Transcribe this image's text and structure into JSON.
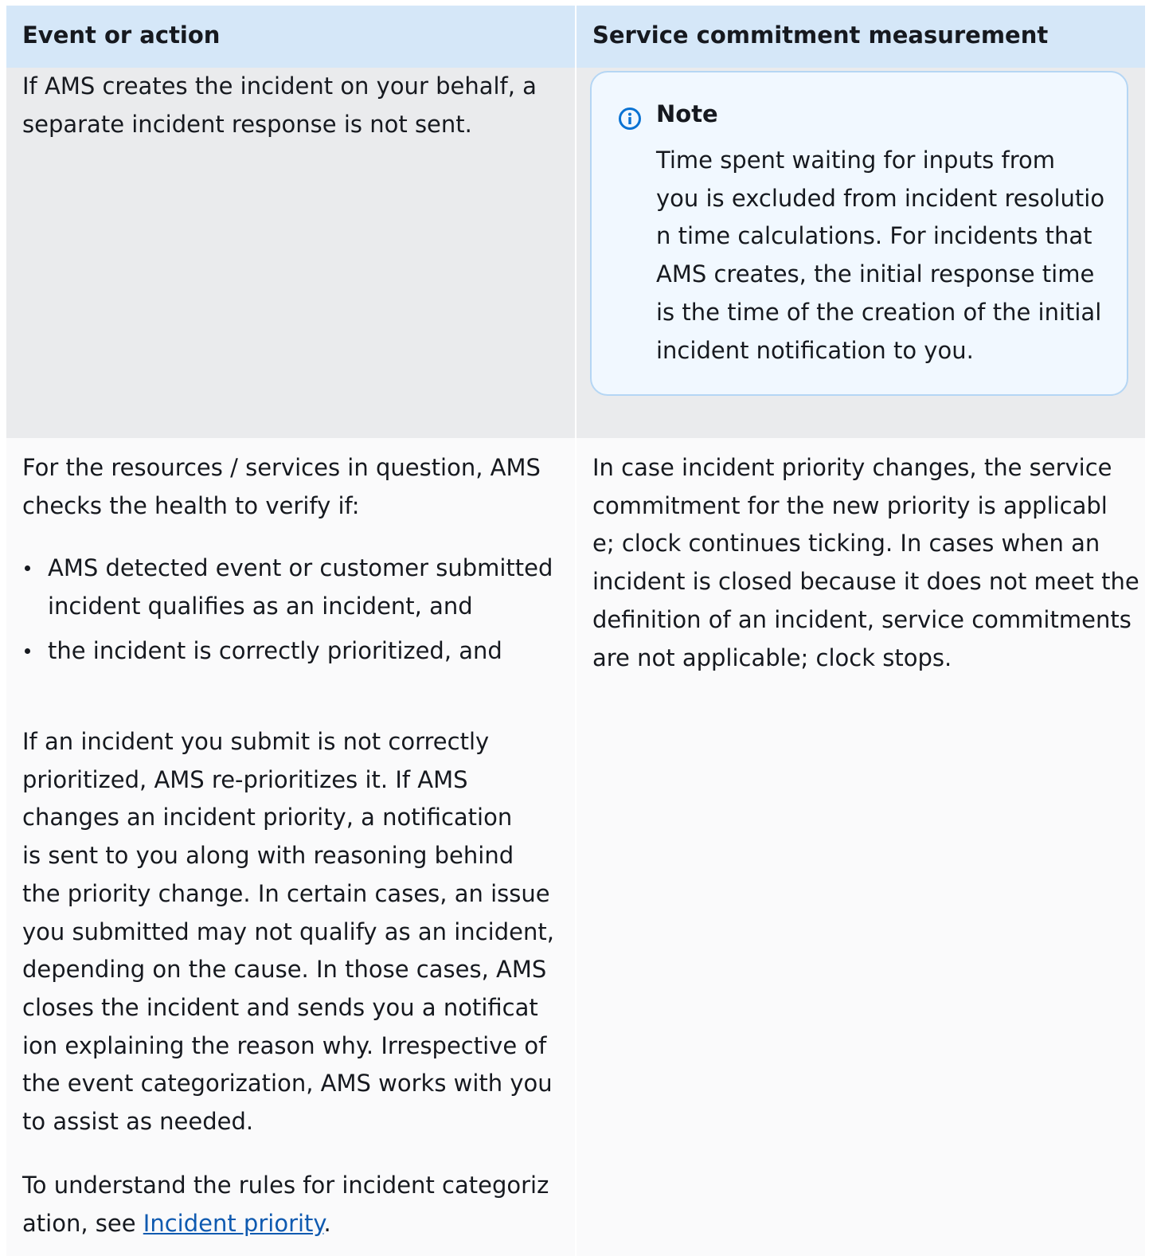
{
  "table": {
    "headers": [
      "Event or action",
      "Service commitment measurement"
    ],
    "row1": {
      "left_lines": [
        "If AMS creates the incident on your behalf, a",
        "separate incident response is not sent."
      ],
      "note": {
        "title": "Note",
        "icon": "info-icon",
        "lines": [
          "Time spent waiting for inputs from",
          "you is excluded from incident resolutio",
          "n time calculations. For incidents that",
          "AMS creates, the initial response time",
          "is the time of the creation of the initial",
          "incident notification to you."
        ]
      }
    },
    "row2": {
      "intro_lines": [
        "For the resources / services in question, AMS",
        "checks the health to verify if:"
      ],
      "bullets": [
        [
          "AMS detected event or customer submitted",
          "incident qualifies as an incident, and"
        ],
        [
          "the incident is correctly prioritized, and"
        ]
      ],
      "para_lines": [
        "If an incident you submit is not correctly",
        "prioritized, AMS re-prioritizes it. If AMS",
        "changes an incident priority, a notification",
        "is sent to you along with reasoning behind",
        "the priority change. In certain cases, an issue",
        "you submitted may not qualify as an incident,",
        "depending on the cause. In those cases, AMS",
        "closes the incident and sends you a notificat",
        "ion explaining the reason why. Irrespective of",
        "the event categorization, AMS works with you",
        "to assist as needed."
      ],
      "rules_line1": "To understand the rules for incident categoriz",
      "rules_line2_prefix": "ation, see ",
      "rules_link": "Incident priority",
      "rules_line2_suffix": ".",
      "right_lines": [
        "In case incident priority changes, the service",
        "commitment for the new priority is applicabl",
        "e; clock continues ticking. In cases when an",
        "incident is closed because it does not meet the",
        "definition of an incident, service commitments",
        "are not applicable; clock stops."
      ]
    },
    "colors": {
      "header_bg": "#d5e7f8",
      "row1_bg": "#eaebed",
      "row2_bg": "#fafafb",
      "note_bg": "#f1f8ff",
      "note_border": "#b5d6f4",
      "link": "#0f5ab0"
    }
  }
}
